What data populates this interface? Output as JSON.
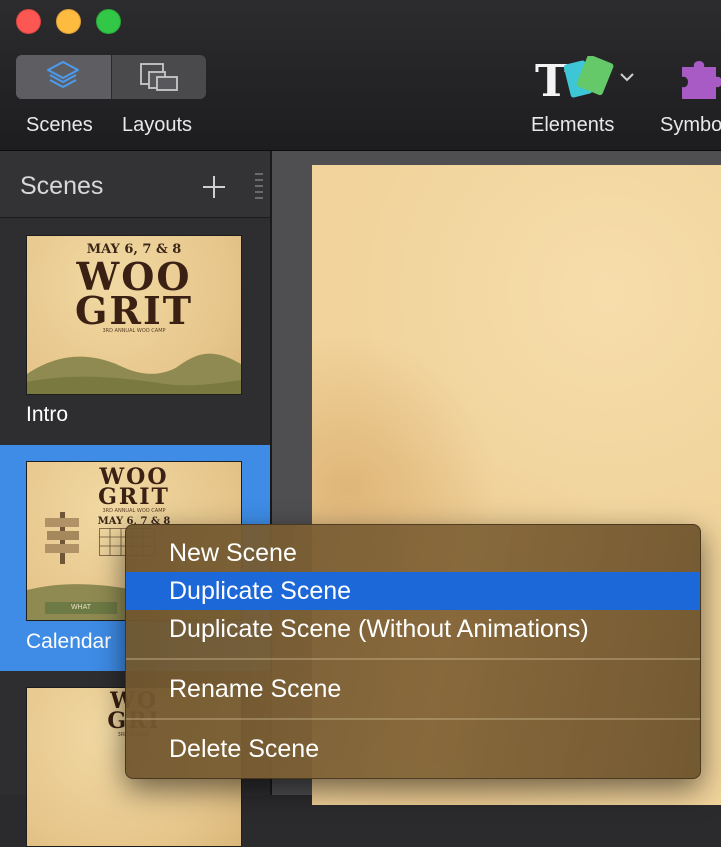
{
  "toolbar": {
    "scenes_label": "Scenes",
    "layouts_label": "Layouts",
    "elements_label": "Elements",
    "symbols_label": "Symbo",
    "icons": {
      "scenes": "layers-icon",
      "layouts": "layouts-icon",
      "elements": "elements-icon",
      "elements_menu": "chevron-down-icon",
      "symbols": "puzzle-piece-icon"
    }
  },
  "sidebar": {
    "title": "Scenes",
    "add_icon": "plus-icon",
    "grip_icon": "grip-icon",
    "scenes": [
      {
        "label": "Intro",
        "poster": {
          "date": "MAY 6, 7 & 8",
          "title_line1": "WOO",
          "title_line2": "GRIT",
          "sub": "3RD ANNUAL WOO CAMP"
        }
      },
      {
        "label": "Calendar",
        "poster": {
          "title_line1": "WOO",
          "title_line2": "GRIT",
          "sub": "3RD ANNUAL WOO CAMP",
          "date": "MAY 6, 7 & 8",
          "banner": "WHAT"
        }
      },
      {
        "label": "",
        "poster": {
          "title_line1": "WO",
          "title_line2": "GRI",
          "sub": "3RD ANNUAL"
        }
      }
    ]
  },
  "context_menu": {
    "items": [
      {
        "label": "New Scene",
        "highlighted": false
      },
      {
        "label": "Duplicate Scene",
        "highlighted": true
      },
      {
        "label": "Duplicate Scene (Without Animations)",
        "highlighted": false
      },
      {
        "label": "Rename Scene",
        "highlighted": false
      },
      {
        "label": "Delete Scene",
        "highlighted": false
      }
    ]
  },
  "colors": {
    "selection": "#3e8ce6",
    "menu_highlight": "#1c68d9",
    "toolbar_bg": "#1d1d1f",
    "paper": "#f1d39b"
  }
}
